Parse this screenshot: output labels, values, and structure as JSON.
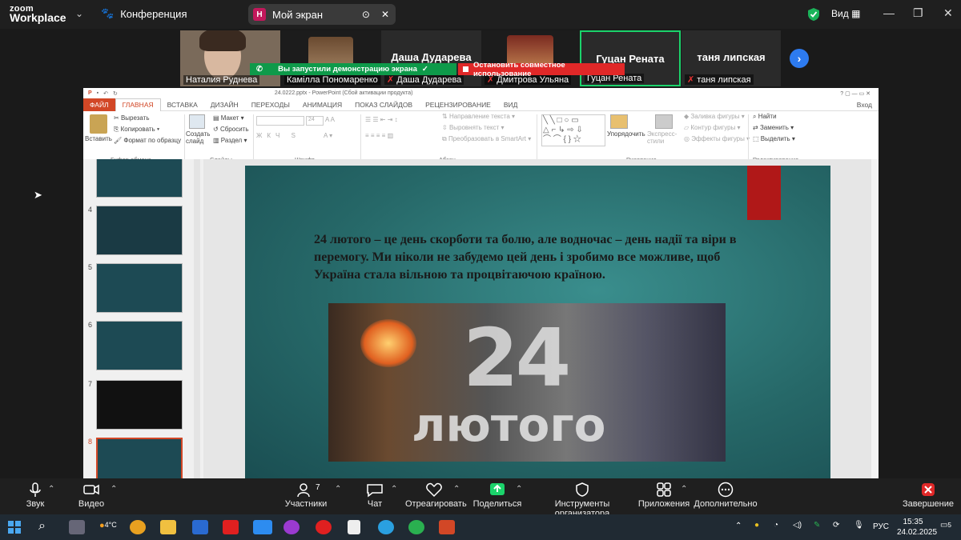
{
  "zoom": {
    "logo_line1": "zoom",
    "logo_line2": "Workplace",
    "conference_label": "Конференция",
    "share_tab_letter": "Н",
    "share_tab_label": "Мой экран",
    "view_label": "Вид",
    "share_started": "Вы запустили демонстрацию экрана",
    "stop_sharing": "Остановить совместное использование"
  },
  "participants": [
    {
      "name": "Наталия Руднева",
      "big": ""
    },
    {
      "name": "Камілла Пономаренко",
      "big": ""
    },
    {
      "name": "Даша Дударева",
      "big": "Даша Дударева"
    },
    {
      "name": "Дмитрова Ульяна",
      "big": ""
    },
    {
      "name": "Гуцан Рената",
      "big": "Гуцан Рената"
    },
    {
      "name": "таня липская",
      "big": "таня липская"
    }
  ],
  "ppt": {
    "window_title": "24.0222.pptx - PowerPoint (Сбой активации продукта)",
    "signin": "Вход",
    "tabs": [
      "ФАЙЛ",
      "ГЛАВНАЯ",
      "ВСТАВКА",
      "ДИЗАЙН",
      "ПЕРЕХОДЫ",
      "АНИМАЦИЯ",
      "ПОКАЗ СЛАЙДОВ",
      "РЕЦЕНЗИРОВАНИЕ",
      "ВИД"
    ],
    "ribbon": {
      "paste": "Вставить",
      "cut": "Вырезать",
      "copy": "Копировать",
      "format_painter": "Формат по образцу",
      "clipboard_group": "Буфер обмена",
      "new_slide": "Создать слайд",
      "layout": "Макет",
      "reset": "Сбросить",
      "section": "Раздел",
      "slides_group": "Слайды",
      "font_size": "24",
      "font_group": "Шрифт",
      "text_direction": "Направление текста",
      "align_text": "Выровнять текст",
      "smartart": "Преобразовать в SmartArt",
      "paragraph_group": "Абзац",
      "arrange": "Упорядочить",
      "quick_styles": "Экспресс-стили",
      "shape_fill": "Заливка фигуры",
      "shape_outline": "Контур фигуры",
      "shape_effects": "Эффекты фигуры",
      "drawing_group": "Рисование",
      "find": "Найти",
      "replace": "Заменить",
      "select": "Выделить",
      "editing_group": "Редактирование"
    },
    "thumb_numbers": [
      "4",
      "5",
      "6",
      "7",
      "8"
    ],
    "slide_text": "24 лютого – це день скорботи та болю, але водночас – день надії та віри в перемогу. Ми ніколи не забудемо цей день і зробимо все можливе, щоб Україна стала вільною та процвітаючою країною.",
    "slide_image_num": "24",
    "slide_image_word": "лютого"
  },
  "controls": [
    {
      "label": "Звук"
    },
    {
      "label": "Видео"
    },
    {
      "label": "Участники",
      "count": "7"
    },
    {
      "label": "Чат"
    },
    {
      "label": "Отреагировать"
    },
    {
      "label": "Поделиться"
    },
    {
      "label": "Инструменты организатора"
    },
    {
      "label": "Приложения"
    },
    {
      "label": "Дополнительно"
    },
    {
      "label": "Завершение"
    }
  ],
  "taskbar": {
    "weather": "4°C",
    "lang": "РУС",
    "time": "15:35",
    "date": "24.02.2025",
    "notif_count": "5"
  },
  "colors": {
    "zoom_bg": "#1f1f1f",
    "ppt_accent": "#d24726",
    "share_green": "#0e9a4a",
    "stop_red": "#e02828",
    "active_speaker": "#1bd36b"
  }
}
